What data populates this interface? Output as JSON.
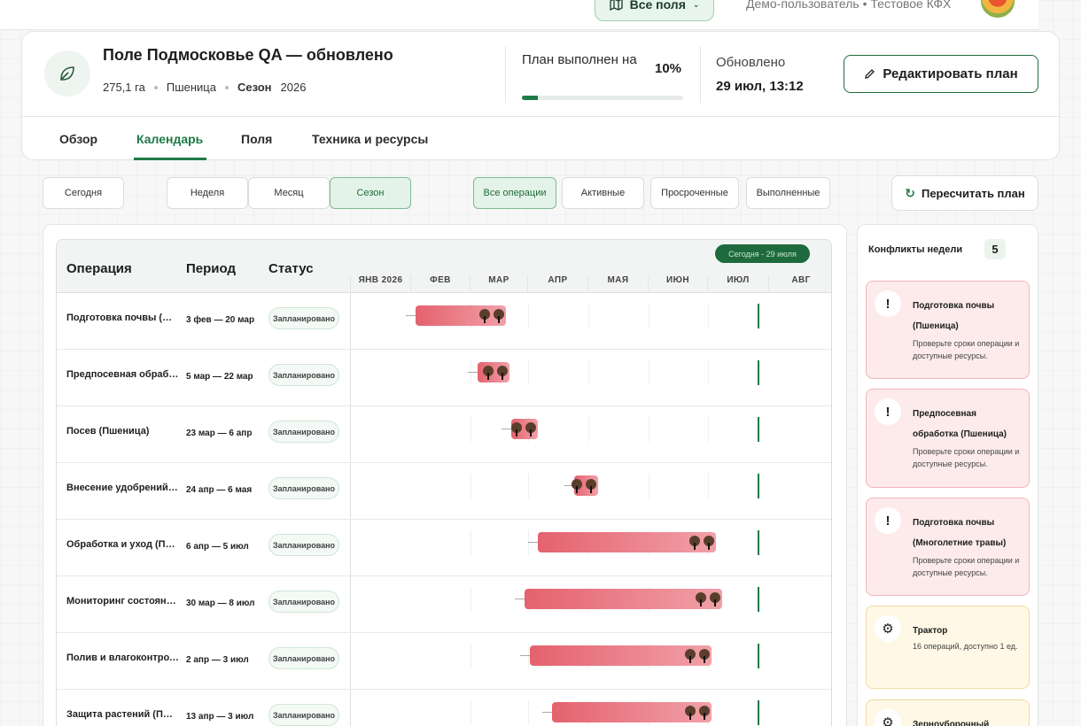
{
  "topbar": {
    "all_fields": "Все поля",
    "user": "Демо-пользователь • Тестовое КФХ"
  },
  "field": {
    "title": "Поле Подмосковье QA — обновлено",
    "area": "275,1 га",
    "crop": "Пшеница",
    "season_label": "Сезон",
    "season_value": "2026",
    "plan_label": "План выполнен на",
    "plan_pct": "10%",
    "plan_fraction": 0.1,
    "updated_label": "Обновлено",
    "updated_value": "29 июл, 13:12",
    "edit_label": "Редактировать план"
  },
  "tabs": [
    "Обзор",
    "Календарь",
    "Поля",
    "Техника и ресурсы"
  ],
  "toolbar": {
    "today": "Сегодня",
    "views": [
      "Неделя",
      "Месяц",
      "Сезон"
    ],
    "filters": [
      "Все операции",
      "Активные",
      "Просроченные",
      "Выполненные"
    ],
    "recalc": "Пересчитать план"
  },
  "gantt": {
    "headers": {
      "op": "Операция",
      "period": "Период",
      "status": "Статус"
    },
    "today_badge": "Сегодня - 29 июля",
    "months": [
      "ЯНВ 2026",
      "ФЕВ",
      "МАР",
      "АПР",
      "МАЯ",
      "ИЮН",
      "ИЮЛ",
      "АВГ"
    ],
    "rows": [
      {
        "name": "Подготовка почвы (Пшеница)",
        "period": "3 фев — 20 мар",
        "status": "Запланировано"
      },
      {
        "name": "Предпосевная обработка (Пшеница)",
        "period": "5 мар — 22 мар",
        "status": "Запланировано"
      },
      {
        "name": "Посев (Пшеница)",
        "period": "23 мар — 6 апр",
        "status": "Запланировано"
      },
      {
        "name": "Внесение удобрений (Пшеница)",
        "period": "24 апр — 6 мая",
        "status": "Запланировано"
      },
      {
        "name": "Обработка и уход (Пшеница)",
        "period": "6 апр — 5 июл",
        "status": "Запланировано"
      },
      {
        "name": "Мониторинг состояния (Пшеница)",
        "period": "30 мар — 8 июл",
        "status": "Запланировано"
      },
      {
        "name": "Полив и влагоконтроль (Пшеница)",
        "period": "2 апр — 3 июл",
        "status": "Запланировано"
      },
      {
        "name": "Защита растений (Пшеница)",
        "period": "13 апр — 3 июл",
        "status": "Запланировано"
      }
    ]
  },
  "conflicts": {
    "title": "Конфликты недели",
    "count": "5",
    "items": [
      {
        "icon": "!",
        "title": "Подготовка почвы (Пшеница)",
        "desc": "Проверьте сроки операции и доступные ресурсы."
      },
      {
        "icon": "!",
        "title": "Предпосевная обработка (Пшеница)",
        "desc": "Проверьте сроки операции и доступные ресурсы."
      },
      {
        "icon": "!",
        "title": "Подготовка почвы (Многолетние травы)",
        "desc": "Проверьте сроки операции и доступные ресурсы."
      },
      {
        "icon": "⚙",
        "title": "Трактор",
        "desc": "16 операций, доступно 1 ед."
      },
      {
        "icon": "⚙",
        "title": "Зерноуборочный",
        "desc": ""
      }
    ]
  }
}
